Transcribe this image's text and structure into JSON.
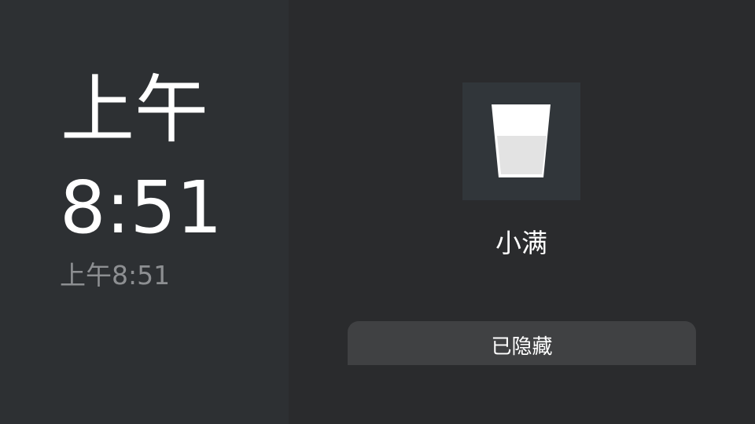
{
  "clock": {
    "period": "上午",
    "time": "8:51",
    "full_time": "上午8:51"
  },
  "item": {
    "icon": "water-glass-icon",
    "name": "小满"
  },
  "action": {
    "hidden_label": "已隐藏"
  },
  "colors": {
    "left_background": "#2d3033",
    "right_background": "#2a2b2d",
    "icon_tile": "#31363a",
    "button_background": "#404143",
    "secondary_text": "#8d8f92"
  }
}
